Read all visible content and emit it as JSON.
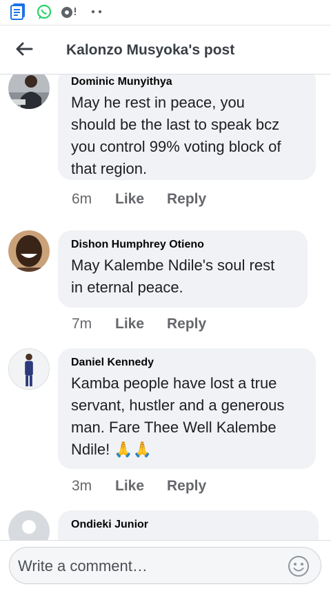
{
  "status_bar": {
    "icons": [
      "document-icon",
      "whatsapp-icon",
      "location-icon",
      "more-dots-icon"
    ]
  },
  "header": {
    "title": "Kalonzo Musyoka's post"
  },
  "comments": [
    {
      "author": "Dominic Munyithya",
      "lines": [
        "May he rest in peace, you",
        "should be the last to speak bcz",
        "you control 99% voting block of",
        "that region."
      ],
      "time": "6m",
      "like": "Like",
      "reply": "Reply"
    },
    {
      "author": "Dishon Humphrey Otieno",
      "lines": [
        "May Kalembe Ndile's soul rest",
        "in eternal peace."
      ],
      "time": "7m",
      "like": "Like",
      "reply": "Reply"
    },
    {
      "author": "Daniel Kennedy",
      "lines": [
        "Kamba people have lost a true",
        "servant, hustler and a generous",
        "man. Fare Thee Well Kalembe",
        "Ndile! 🙏🙏"
      ],
      "time": "3m",
      "like": "Like",
      "reply": "Reply"
    },
    {
      "author": "Ondieki Junior",
      "lines": [],
      "time": "",
      "like": "",
      "reply": ""
    }
  ],
  "composer": {
    "placeholder": "Write a comment…",
    "emoji_icon": "smiley-icon"
  },
  "colors": {
    "bubble": "#f0f2f5",
    "meta": "#65676b",
    "whatsapp": "#25d366",
    "doc_icon": "#1a73e8"
  }
}
